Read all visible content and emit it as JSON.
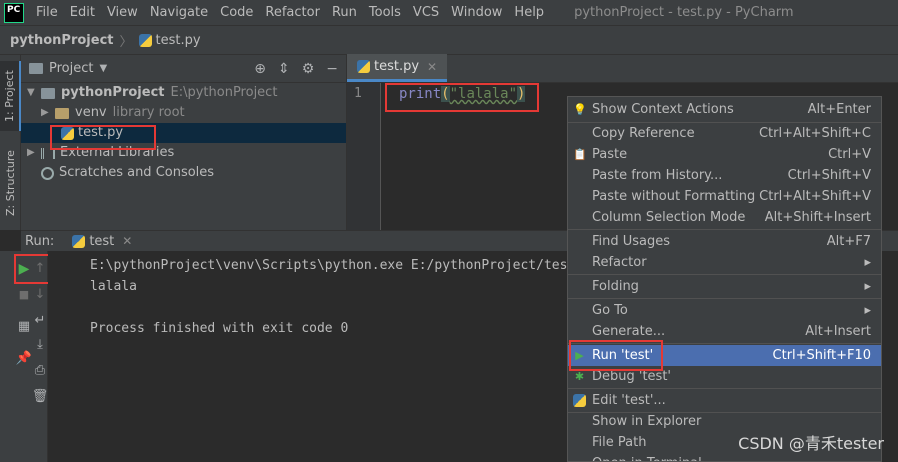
{
  "menubar": {
    "logo": "PC",
    "items": [
      "File",
      "Edit",
      "View",
      "Navigate",
      "Code",
      "Refactor",
      "Run",
      "Tools",
      "VCS",
      "Window",
      "Help"
    ],
    "window_title": "pythonProject - test.py - PyCharm"
  },
  "breadcrumb": {
    "project": "pythonProject",
    "separator": "〉",
    "file": "test.py"
  },
  "side_tabs": {
    "project": "1: Project",
    "structure": "Z: Structure"
  },
  "project_panel": {
    "title": "Project",
    "tree": {
      "root_name": "pythonProject",
      "root_path": "E:\\pythonProject",
      "venv": "venv",
      "venv_note": "library root",
      "file": "test.py",
      "external": "External Libraries",
      "scratches": "Scratches and Consoles"
    }
  },
  "editor": {
    "tab": "test.py",
    "line_number": "1",
    "code": {
      "fn": "print",
      "open": "(",
      "string": "\"lalala\"",
      "close": ")"
    }
  },
  "run_panel": {
    "label": "Run:",
    "tab": "test",
    "console": [
      "E:\\pythonProject\\venv\\Scripts\\python.exe E:/pythonProject/test.py",
      "lalala",
      "",
      "Process finished with exit code 0"
    ]
  },
  "context_menu": {
    "items": [
      {
        "label": "Show Context Actions",
        "shortcut": "Alt+Enter",
        "icon": "bulb-icon"
      },
      {
        "label": "Copy Reference",
        "shortcut": "Ctrl+Alt+Shift+C",
        "icon": ""
      },
      {
        "label": "Paste",
        "shortcut": "Ctrl+V",
        "icon": "clipboard-icon"
      },
      {
        "label": "Paste from History...",
        "shortcut": "Ctrl+Shift+V",
        "icon": ""
      },
      {
        "label": "Paste without Formatting",
        "shortcut": "Ctrl+Alt+Shift+V",
        "icon": ""
      },
      {
        "label": "Column Selection Mode",
        "shortcut": "Alt+Shift+Insert",
        "icon": ""
      },
      {
        "label": "Find Usages",
        "shortcut": "Alt+F7",
        "icon": ""
      },
      {
        "label": "Refactor",
        "shortcut": "▸",
        "icon": ""
      },
      {
        "label": "Folding",
        "shortcut": "▸",
        "icon": ""
      },
      {
        "label": "Go To",
        "shortcut": "▸",
        "icon": ""
      },
      {
        "label": "Generate...",
        "shortcut": "Alt+Insert",
        "icon": ""
      },
      {
        "label": "Run 'test'",
        "shortcut": "Ctrl+Shift+F10",
        "icon": "run-icon"
      },
      {
        "label": "Debug 'test'",
        "shortcut": "",
        "icon": "debug-icon"
      },
      {
        "label": "Edit 'test'...",
        "shortcut": "",
        "icon": "python-icon"
      },
      {
        "label": "Show in Explorer",
        "shortcut": "",
        "icon": ""
      },
      {
        "label": "File Path",
        "shortcut": "",
        "icon": ""
      },
      {
        "label": "Open in Terminal",
        "shortcut": "",
        "icon": ""
      }
    ]
  },
  "watermark": "CSDN @青禾tester",
  "colors": {
    "highlight_box": "#e53935",
    "selection": "#4b6eaf",
    "run_green": "#4caf50"
  }
}
